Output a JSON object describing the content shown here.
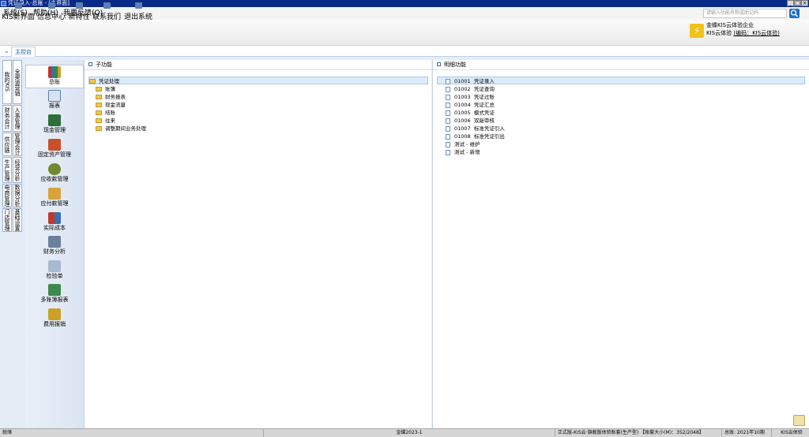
{
  "window": {
    "title": "凭证录入-总账 - [主界面]"
  },
  "menu": [
    "系统(S)",
    "帮助(H)",
    "我要反馈(Q)"
  ],
  "search": {
    "placeholder": "请输入功能名称或助记码"
  },
  "toolbar": [
    {
      "label": "KIS新界面",
      "icon": "new-ui-icon"
    },
    {
      "label": "信息中心",
      "icon": "mail-icon"
    },
    {
      "label": "新特性",
      "icon": "star-icon"
    },
    {
      "label": "联系我们",
      "icon": "chat-icon"
    },
    {
      "label": "退出系统",
      "icon": "exit-icon"
    }
  ],
  "company": {
    "name": "金蝶KIS云体验企业",
    "sub_prefix": "KIS云体验",
    "sub_link": "(编码：KIS云体验)"
  },
  "tab": {
    "label": "主控台"
  },
  "vertical_tabs": [
    "我的KIS",
    "财务会计",
    "供应链",
    "生产管理",
    "电商管理",
    "门店管理",
    "全渠道营销",
    "人事管理",
    "管理会计",
    "经营分析",
    "数据分析",
    "基础设置"
  ],
  "modules": [
    {
      "label": "总账",
      "icon": "books-icon"
    },
    {
      "label": "报表",
      "icon": "report-icon"
    },
    {
      "label": "现金管理",
      "icon": "cash-icon"
    },
    {
      "label": "固定资产管理",
      "icon": "asset-icon"
    },
    {
      "label": "应收款管理",
      "icon": "receivable-icon"
    },
    {
      "label": "应付款管理",
      "icon": "payable-icon"
    },
    {
      "label": "实际成本",
      "icon": "cost-icon"
    },
    {
      "label": "财务分析",
      "icon": "analysis-icon"
    },
    {
      "label": "检验单",
      "icon": "inspection-icon"
    },
    {
      "label": "多账簿报表",
      "icon": "multibook-icon"
    },
    {
      "label": "费用报销",
      "icon": "expense-icon"
    }
  ],
  "left_pane": {
    "header": "子功能",
    "items": [
      "凭证处理",
      "账簿",
      "财务报表",
      "现金流量",
      "结账",
      "往来",
      "调整期间业务处理"
    ]
  },
  "right_pane": {
    "header": "明细功能",
    "items": [
      {
        "code": "01001",
        "label": "凭证录入"
      },
      {
        "code": "01002",
        "label": "凭证查询"
      },
      {
        "code": "01003",
        "label": "凭证过账"
      },
      {
        "code": "01004",
        "label": "凭证汇总"
      },
      {
        "code": "01005",
        "label": "模式凭证"
      },
      {
        "code": "01006",
        "label": "双敲审核"
      },
      {
        "code": "01007",
        "label": "标准凭证引入"
      },
      {
        "code": "01008",
        "label": "标准凭证引出"
      },
      {
        "code": "",
        "label": "测试 - 维护"
      },
      {
        "code": "",
        "label": "测试 - 新增"
      }
    ]
  },
  "status": {
    "ready": "就绪",
    "user": "金蝶2023-1",
    "version": "正式版-KIS云·旗舰版体验账套(生产型) 【账套大小(M)：352/2048】",
    "period": "总账: 2021年10期",
    "product": "KIS云体验"
  },
  "colors": {
    "titlebar": "#0a2a8a",
    "accent": "#1e6fd1",
    "work_bg": "#e4ecf6"
  }
}
